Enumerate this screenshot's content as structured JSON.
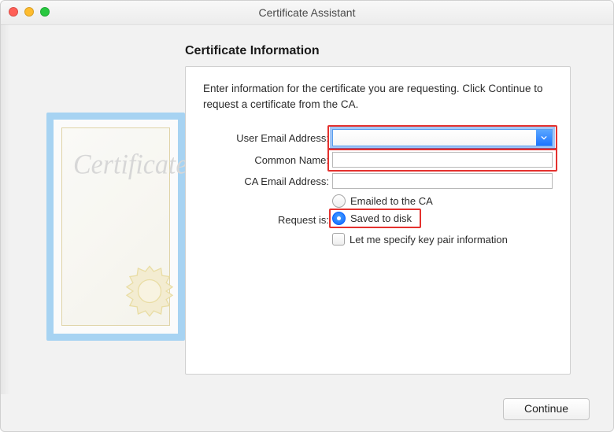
{
  "window": {
    "title": "Certificate Assistant"
  },
  "heading": "Certificate Information",
  "intro": "Enter information for the certificate you are requesting. Click Continue to request a certificate from the CA.",
  "labels": {
    "user_email": "User Email Address:",
    "common_name": "Common Name:",
    "ca_email": "CA Email Address:",
    "request_is": "Request is:"
  },
  "fields": {
    "user_email": "",
    "common_name": "",
    "ca_email": ""
  },
  "options": {
    "emailed": "Emailed to the CA",
    "saved": "Saved to disk",
    "selected": "saved"
  },
  "checkbox": {
    "label": "Let me specify key pair information",
    "checked": false
  },
  "buttons": {
    "continue": "Continue"
  },
  "decorative_text": "Certificate"
}
